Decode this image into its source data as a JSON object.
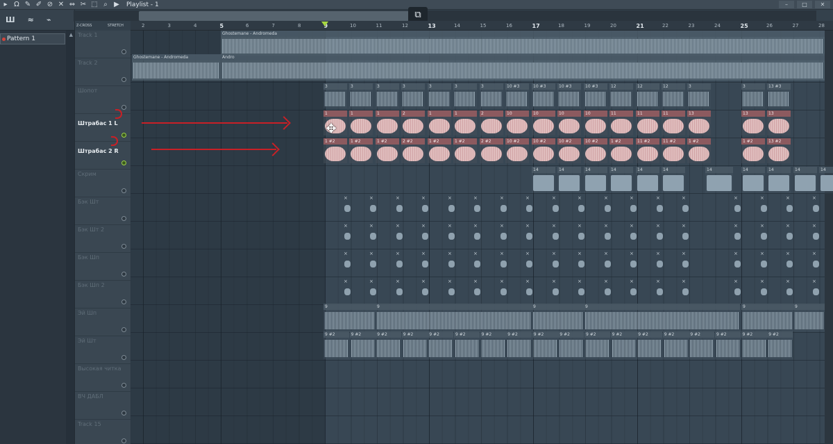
{
  "window": {
    "title": "Playlist - 1"
  },
  "toolbar": {
    "icons": [
      "magnet-icon",
      "pencil-icon",
      "brush-icon",
      "delete-icon",
      "mute-icon",
      "slip-icon",
      "slice-icon",
      "select-icon",
      "zoom-icon",
      "play-icon"
    ]
  },
  "left_panel": {
    "tab1": "Ш",
    "pattern": "Pattern 1"
  },
  "header_controls": {
    "cross": "Z-CROSS",
    "stretch": "STRETCH",
    "arrow_label": "Ш"
  },
  "ruler": [
    "2",
    "3",
    "4",
    "5",
    "6",
    "7",
    "8",
    "9",
    "10",
    "11",
    "12",
    "13",
    "14",
    "15",
    "16",
    "17",
    "18",
    "19",
    "20",
    "21",
    "22",
    "23",
    "24",
    "25",
    "26",
    "27",
    "28"
  ],
  "tracks": [
    {
      "name": "Track 1",
      "active": false,
      "led": false
    },
    {
      "name": "Track 2",
      "active": false,
      "led": false
    },
    {
      "name": "Шопот",
      "active": false,
      "led": false
    },
    {
      "name": "Штрабас 1 L",
      "active": true,
      "led": true
    },
    {
      "name": "Штрабас 2 R",
      "active": true,
      "led": true
    },
    {
      "name": "Скрим",
      "active": false,
      "led": false
    },
    {
      "name": "Бэк Шт",
      "active": false,
      "led": false
    },
    {
      "name": "Бэк Шт 2",
      "active": false,
      "led": false
    },
    {
      "name": "Бэк Шп",
      "active": false,
      "led": false
    },
    {
      "name": "Бэк Шп 2",
      "active": false,
      "led": false
    },
    {
      "name": "Эй Шп",
      "active": false,
      "led": false
    },
    {
      "name": "Эй Шт",
      "active": false,
      "led": false
    },
    {
      "name": "Высокая читка",
      "active": false,
      "led": false
    },
    {
      "name": "ВЧ ДАБЛ",
      "active": false,
      "led": false
    },
    {
      "name": "Track 15",
      "active": false,
      "led": false
    }
  ],
  "clips": {
    "track1_main": "Ghostemane - Andromeda",
    "track2_a": "Ghostemane - Andromeda",
    "track2_b": "Andro",
    "shopot": [
      "3",
      "3",
      "3",
      "3",
      "3",
      "3",
      "3",
      "10 #3",
      "10 #3",
      "10 #3",
      "10 #3",
      "12",
      "12",
      "12",
      "3",
      "3",
      "13 #3"
    ],
    "shtrabas1": [
      "1",
      "1",
      "1",
      "2",
      "1",
      "1",
      "2",
      "10",
      "10",
      "10",
      "10",
      "11",
      "11",
      "11",
      "13",
      "13",
      "13"
    ],
    "shtrabas2": [
      "1 #2",
      "1 #2",
      "1 #2",
      "2 #2",
      "1 #2",
      "1 #2",
      "2 #2",
      "10 #2",
      "10 #2",
      "10 #2",
      "10 #2",
      "1 #2",
      "11 #2",
      "11 #2",
      "1 #2",
      "1 #2",
      "13 #2"
    ],
    "skrim": [
      "14",
      "14",
      "14",
      "14",
      "14",
      "14",
      "14",
      "14",
      "14",
      "14",
      "14"
    ],
    "ey_shp": [
      "9",
      "9",
      "9",
      "9",
      "9",
      "9"
    ],
    "ey_sht": [
      "9 #2",
      "9 #2",
      "9 #2",
      "9 #2",
      "9 #2",
      "9 #2",
      "9 #2",
      "9 #2",
      "9 #2",
      "9 #2",
      "9 #2",
      "9 #2",
      "9 #2",
      "9 #2",
      "9 #2",
      "9 #2",
      "9 #2",
      "9 #2"
    ]
  }
}
